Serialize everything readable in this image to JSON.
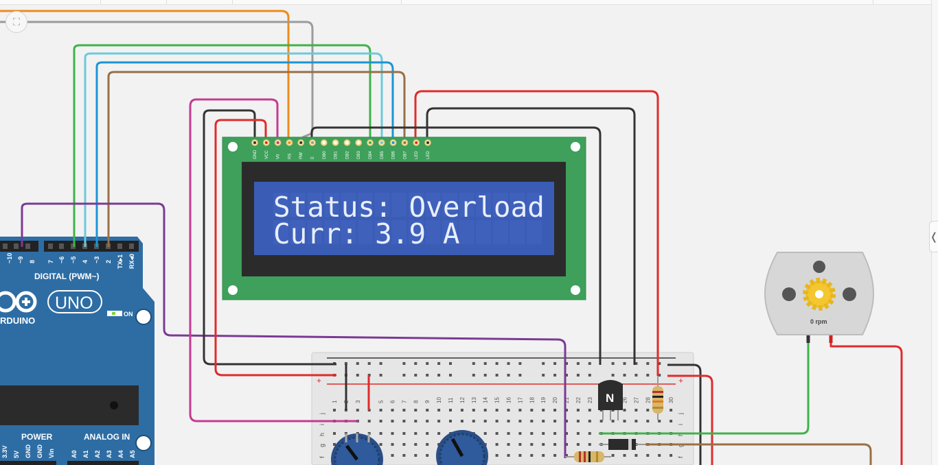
{
  "toolbar": {
    "fit_icon": "fit-to-view-icon"
  },
  "side_panel": {
    "toggle_icon": "chevron-left-icon",
    "toggle_glyph": "❬"
  },
  "lcd": {
    "pin_labels": [
      "GND",
      "VCC",
      "V0",
      "RS",
      "RW",
      "E",
      "DB0",
      "DB1",
      "DB2",
      "DB3",
      "DB4",
      "DB5",
      "DB6",
      "DB7",
      "LED",
      "LED"
    ],
    "line1": "Status: Overload",
    "line2": "Curr: 3.9 A",
    "screen_color": "#3a5cb5",
    "board_color": "#3ea05a"
  },
  "arduino": {
    "digital_label": "DIGITAL (PWM~)",
    "pin_labels_top": [
      "~10",
      "~9",
      "8",
      "7",
      "~6",
      "~5",
      "4",
      "~3",
      "2",
      "TX▸1",
      "RX◂0"
    ],
    "brand": "RDUINO",
    "model": "UNO",
    "on_label": "ON",
    "power_label": "POWER",
    "analog_label": "ANALOG IN",
    "power_pins": [
      "3.3V",
      "5V",
      "GND",
      "GND",
      "Vin"
    ],
    "analog_pins": [
      "A0",
      "A1",
      "A2",
      "A3",
      "A4",
      "A5"
    ],
    "board_color": "#2e6da4"
  },
  "breadboard": {
    "plus_label": "+",
    "column_numbers": [
      "1",
      "2",
      "3",
      "5",
      "6",
      "7",
      "8",
      "9",
      "10",
      "11",
      "12",
      "13",
      "14",
      "15",
      "16",
      "17",
      "18",
      "19",
      "20",
      "21",
      "22",
      "23",
      "25",
      "26",
      "27",
      "28",
      "30"
    ],
    "row_letters": [
      "j",
      "i",
      "h",
      "g",
      "f"
    ]
  },
  "transistor": {
    "label": "N"
  },
  "motor": {
    "speed_label": "0 rpm"
  },
  "wire_colors": {
    "orange": "#ee8a1c",
    "gray": "#9b9b9b",
    "green": "#3db34a",
    "lightblue": "#6cc9dc",
    "blue": "#1b95d3",
    "brown": "#9a6f45",
    "purple": "#7a3a93",
    "magenta": "#c43a92",
    "black": "#333333",
    "red": "#e02b2b"
  }
}
